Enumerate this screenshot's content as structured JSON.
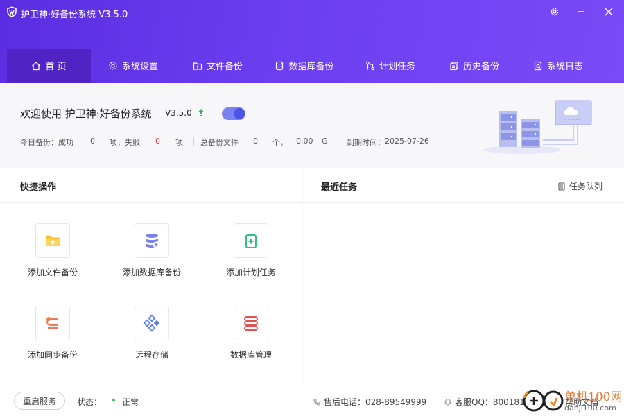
{
  "app": {
    "title": "护卫神·好备份系统 V3.5.0"
  },
  "nav": {
    "items": [
      {
        "label": "首 页",
        "icon": "home-icon"
      },
      {
        "label": "系统设置",
        "icon": "gear-icon"
      },
      {
        "label": "文件备份",
        "icon": "folder-plus-icon"
      },
      {
        "label": "数据库备份",
        "icon": "database-icon"
      },
      {
        "label": "计划任务",
        "icon": "schedule-icon"
      },
      {
        "label": "历史备份",
        "icon": "history-icon"
      },
      {
        "label": "系统日志",
        "icon": "log-icon"
      }
    ]
  },
  "welcome": {
    "title": "欢迎使用 护卫神·好备份系统",
    "version": "V3.5.0",
    "stats": {
      "today_label": "今日备份：成功",
      "success_count": "0",
      "success_unit": "项，失败",
      "fail_count": "0",
      "fail_unit": "项",
      "total_label": "总备份文件",
      "total_count": "0",
      "total_unit": "个，",
      "total_size": "0.00",
      "size_unit": "G",
      "expire_label": "到期时间：",
      "expire_date": "2025-07-26"
    }
  },
  "quick": {
    "title": "快捷操作",
    "tiles": [
      {
        "label": "添加文件备份",
        "icon": "folder-upload-icon"
      },
      {
        "label": "添加数据库备份",
        "icon": "database-add-icon"
      },
      {
        "label": "添加计划任务",
        "icon": "clipboard-add-icon"
      },
      {
        "label": "添加同步备份",
        "icon": "sync-icon"
      },
      {
        "label": "远程存储",
        "icon": "remote-storage-icon"
      },
      {
        "label": "数据库管理",
        "icon": "database-manage-icon"
      }
    ]
  },
  "recent": {
    "title": "最近任务",
    "queue_label": "任务队列"
  },
  "footer": {
    "restart_label": "重启服务",
    "status_label": "状态：",
    "status_value": "正常",
    "phone_label": "售后电话：028-89549999",
    "qq_label": "客服QQ：800181913",
    "help_label": "帮助文档"
  },
  "watermark": {
    "line1": "单机100网",
    "line2": "danji100.com"
  },
  "colors": {
    "header_start": "#5a2ee0",
    "header_end": "#7a4af6",
    "nav_active": "#5223c4",
    "fail_red": "#e23b3b",
    "status_green": "#3cc05c",
    "toggle": "#4d55e6"
  }
}
